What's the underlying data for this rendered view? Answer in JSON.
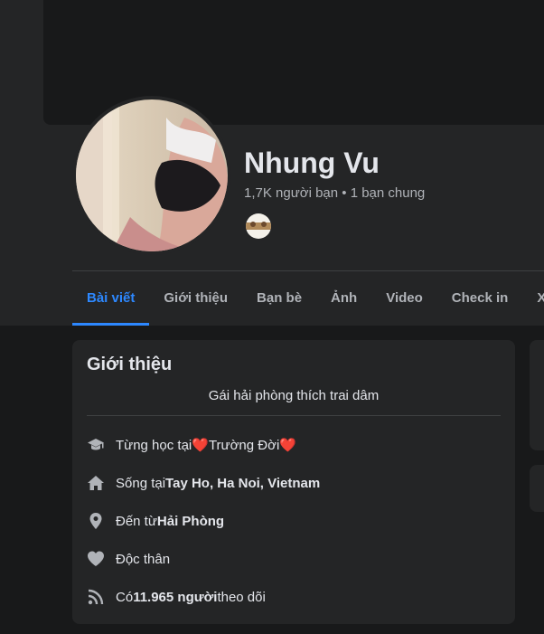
{
  "profile": {
    "name": "Nhung Vu",
    "friend_summary": "1,7K người bạn • 1 bạn chung"
  },
  "tabs": [
    {
      "label": "Bài viết",
      "active": true
    },
    {
      "label": "Giới thiệu",
      "active": false
    },
    {
      "label": "Bạn bè",
      "active": false
    },
    {
      "label": "Ảnh",
      "active": false
    },
    {
      "label": "Video",
      "active": false
    },
    {
      "label": "Check in",
      "active": false
    },
    {
      "label": "Xem",
      "active": false
    }
  ],
  "intro": {
    "title": "Giới thiệu",
    "bio": "Gái hải phòng thích trai dâm",
    "education": {
      "prefix": "Từng học tại ",
      "heart_left": "❤️",
      "school": "Trường Đời",
      "heart_right": "❤️",
      "icon": "graduation-cap-icon"
    },
    "lives_in": {
      "prefix": "Sống tại ",
      "value": "Tay Ho, Ha Noi, Vietnam",
      "icon": "home-icon"
    },
    "from": {
      "prefix": "Đến từ ",
      "value": "Hải Phòng",
      "icon": "location-pin-icon"
    },
    "relationship": {
      "value": "Độc thân",
      "icon": "heart-icon"
    },
    "followers": {
      "prefix": "Có ",
      "value": "11.965 người",
      "suffix": " theo dõi",
      "icon": "rss-feed-icon"
    }
  },
  "colors": {
    "background": "#18191a",
    "card": "#242526",
    "accent": "#2d88ff",
    "text_primary": "#e4e6eb",
    "text_secondary": "#b0b3b8",
    "heart": "#f02849"
  }
}
